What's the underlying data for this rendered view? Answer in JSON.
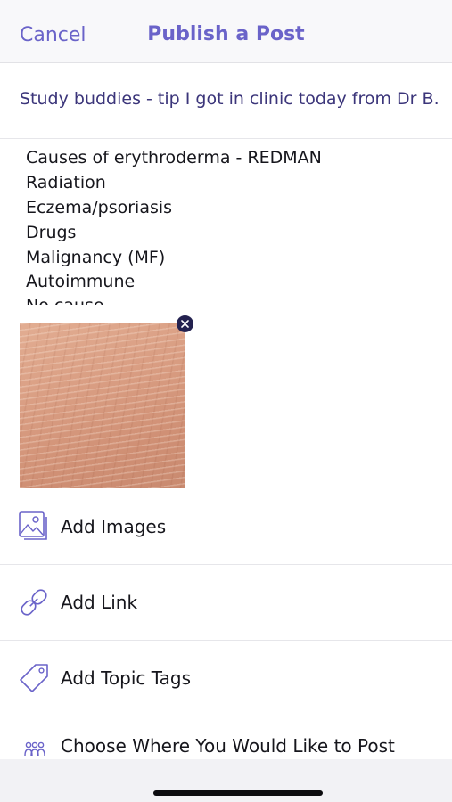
{
  "header": {
    "cancel_label": "Cancel",
    "title": "Publish a Post"
  },
  "post": {
    "title": "Study buddies - tip I got in clinic today from Dr B.",
    "body_lines": [
      "Causes of erythroderma - REDMAN",
      "Radiation",
      "Eczema/psoriasis",
      "Drugs",
      "Malignancy (MF)",
      "Autoimmune",
      "No cause"
    ]
  },
  "attachment": {
    "remove_icon": "close-icon"
  },
  "actions": [
    {
      "label": "Add Images",
      "icon": "images-icon"
    },
    {
      "label": "Add Link",
      "icon": "link-icon"
    },
    {
      "label": "Add Topic Tags",
      "icon": "tag-icon"
    },
    {
      "label": "Choose Where You Would Like to Post",
      "icon": "group-icon"
    }
  ],
  "colors": {
    "accent": "#6a63c9",
    "title_text": "#3b357a",
    "remove_badge": "#23214f"
  }
}
